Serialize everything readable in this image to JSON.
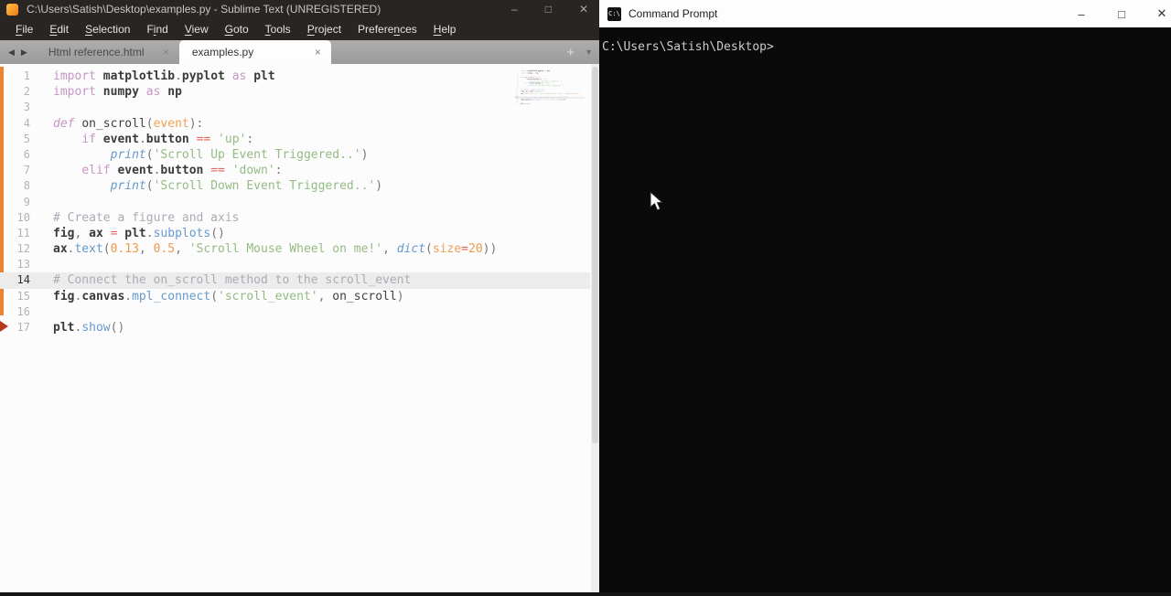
{
  "colors": {
    "kw": "#c794c7",
    "fn": "#6699cc",
    "str": "#94bb83",
    "num": "#f09a4b",
    "op": "#e8635a",
    "param": "#efa055",
    "varc": "#3a3a3a",
    "pun": "#777777",
    "com": "#a8adb5",
    "accent": "#ea8334",
    "marker": "#b5381f"
  },
  "sublime": {
    "title": "C:\\Users\\Satish\\Desktop\\examples.py - Sublime Text (UNREGISTERED)",
    "controls": [
      "–",
      "□",
      "✕"
    ],
    "menu": [
      {
        "label": "File",
        "u": 0
      },
      {
        "label": "Edit",
        "u": 0
      },
      {
        "label": "Selection",
        "u": 0
      },
      {
        "label": "Find",
        "u": 1
      },
      {
        "label": "View",
        "u": 0
      },
      {
        "label": "Goto",
        "u": 0
      },
      {
        "label": "Tools",
        "u": 0
      },
      {
        "label": "Project",
        "u": 0
      },
      {
        "label": "Preferences",
        "u": 7
      },
      {
        "label": "Help",
        "u": 0
      }
    ],
    "tabbar": {
      "back": "◀",
      "forward": "▶",
      "new_tab": "+",
      "more": "▼",
      "tab_close": "×"
    },
    "tabs": [
      {
        "label": "Html reference.html",
        "active": false
      },
      {
        "label": "examples.py",
        "active": true
      }
    ],
    "editor": {
      "current_line": 14,
      "lines": [
        [
          [
            "kw",
            "import"
          ],
          [
            "txt",
            " "
          ],
          [
            "var",
            "matplotlib"
          ],
          [
            "pun",
            "."
          ],
          [
            "var",
            "pyplot"
          ],
          [
            "txt",
            " "
          ],
          [
            "kw",
            "as"
          ],
          [
            "txt",
            " "
          ],
          [
            "var",
            "plt"
          ]
        ],
        [
          [
            "kw",
            "import"
          ],
          [
            "txt",
            " "
          ],
          [
            "var",
            "numpy"
          ],
          [
            "txt",
            " "
          ],
          [
            "kw",
            "as"
          ],
          [
            "txt",
            " "
          ],
          [
            "var",
            "np"
          ]
        ],
        [],
        [
          [
            "kwi",
            "def"
          ],
          [
            "txt",
            " "
          ],
          [
            "txt",
            "on_scroll"
          ],
          [
            "pun",
            "("
          ],
          [
            "param",
            "event"
          ],
          [
            "pun",
            "):"
          ]
        ],
        [
          [
            "txt",
            "    "
          ],
          [
            "kw",
            "if"
          ],
          [
            "txt",
            " "
          ],
          [
            "var",
            "event"
          ],
          [
            "pun",
            "."
          ],
          [
            "var",
            "button"
          ],
          [
            "txt",
            " "
          ],
          [
            "op",
            "=="
          ],
          [
            "txt",
            " "
          ],
          [
            "str",
            "'up'"
          ],
          [
            "pun",
            ":"
          ]
        ],
        [
          [
            "txt",
            "        "
          ],
          [
            "fni",
            "print"
          ],
          [
            "pun",
            "("
          ],
          [
            "str",
            "'Scroll Up Event Triggered..'"
          ],
          [
            "pun",
            ")"
          ]
        ],
        [
          [
            "txt",
            "    "
          ],
          [
            "kw",
            "elif"
          ],
          [
            "txt",
            " "
          ],
          [
            "var",
            "event"
          ],
          [
            "pun",
            "."
          ],
          [
            "var",
            "button"
          ],
          [
            "txt",
            " "
          ],
          [
            "op",
            "=="
          ],
          [
            "txt",
            " "
          ],
          [
            "str",
            "'down'"
          ],
          [
            "pun",
            ":"
          ]
        ],
        [
          [
            "txt",
            "        "
          ],
          [
            "fni",
            "print"
          ],
          [
            "pun",
            "("
          ],
          [
            "str",
            "'Scroll Down Event Triggered..'"
          ],
          [
            "pun",
            ")"
          ]
        ],
        [],
        [
          [
            "com",
            "# Create a figure and axis"
          ]
        ],
        [
          [
            "var",
            "fig"
          ],
          [
            "pun",
            ","
          ],
          [
            "txt",
            " "
          ],
          [
            "var",
            "ax"
          ],
          [
            "txt",
            " "
          ],
          [
            "op",
            "="
          ],
          [
            "txt",
            " "
          ],
          [
            "var",
            "plt"
          ],
          [
            "pun",
            "."
          ],
          [
            "fn",
            "subplots"
          ],
          [
            "pun",
            "()"
          ]
        ],
        [
          [
            "var",
            "ax"
          ],
          [
            "pun",
            "."
          ],
          [
            "fn",
            "text"
          ],
          [
            "pun",
            "("
          ],
          [
            "num",
            "0.13"
          ],
          [
            "pun",
            ","
          ],
          [
            "txt",
            " "
          ],
          [
            "num",
            "0.5"
          ],
          [
            "pun",
            ","
          ],
          [
            "txt",
            " "
          ],
          [
            "str",
            "'Scroll Mouse Wheel on me!'"
          ],
          [
            "pun",
            ","
          ],
          [
            "txt",
            " "
          ],
          [
            "fni",
            "dict"
          ],
          [
            "pun",
            "("
          ],
          [
            "param",
            "size"
          ],
          [
            "op",
            "="
          ],
          [
            "num",
            "20"
          ],
          [
            "pun",
            "))"
          ]
        ],
        [],
        [
          [
            "com",
            "# Connect the on_scroll method to the scroll_event"
          ]
        ],
        [
          [
            "var",
            "fig"
          ],
          [
            "pun",
            "."
          ],
          [
            "var",
            "canvas"
          ],
          [
            "pun",
            "."
          ],
          [
            "fn",
            "mpl_connect"
          ],
          [
            "pun",
            "("
          ],
          [
            "str",
            "'scroll_event'"
          ],
          [
            "pun",
            ","
          ],
          [
            "txt",
            " "
          ],
          [
            "txt",
            "on_scroll"
          ],
          [
            "pun",
            ")"
          ]
        ],
        [],
        [
          [
            "var",
            "plt"
          ],
          [
            "pun",
            "."
          ],
          [
            "fn",
            "show"
          ],
          [
            "pun",
            "()"
          ]
        ]
      ]
    }
  },
  "cmd": {
    "title": "Command Prompt",
    "icon_label": "C:\\",
    "controls": [
      "–",
      "□",
      "✕"
    ],
    "prompt": "C:\\Users\\Satish\\Desktop>"
  }
}
